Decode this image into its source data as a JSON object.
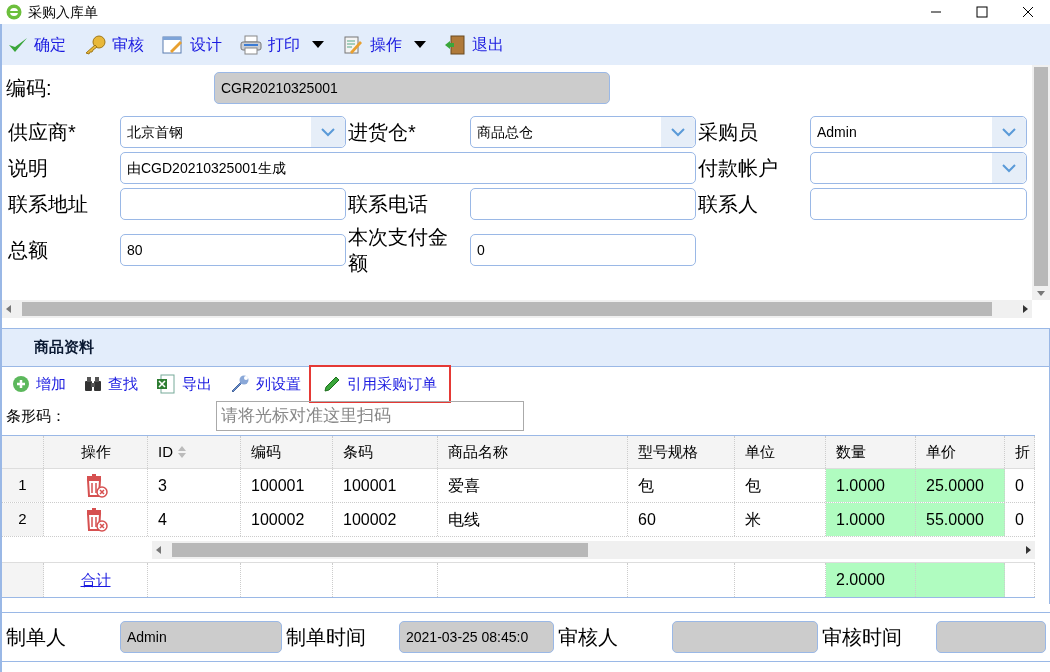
{
  "window": {
    "title": "采购入库单"
  },
  "toolbar": [
    {
      "label": "确定",
      "dropdown": false
    },
    {
      "label": "审核",
      "dropdown": false
    },
    {
      "label": "设计",
      "dropdown": false
    },
    {
      "label": "打印",
      "dropdown": true
    },
    {
      "label": "操作",
      "dropdown": true
    },
    {
      "label": "退出",
      "dropdown": false
    }
  ],
  "form": {
    "code": {
      "label": "编码:",
      "value": "CGR20210325001"
    },
    "rows": [
      [
        {
          "label": "供应商*",
          "value": "北京首钢",
          "kind": "select"
        },
        {
          "label": "进货仓*",
          "value": "商品总仓",
          "kind": "select"
        },
        {
          "label": "采购员",
          "value": "Admin",
          "kind": "select"
        }
      ],
      [
        {
          "label": "说明",
          "value": "由CGD20210325001生成",
          "kind": "text",
          "colspan": 3
        },
        {
          "label": "付款帐户",
          "kind": "select"
        }
      ],
      [
        {
          "label": "联系地址",
          "kind": "text"
        },
        {
          "label": "联系电话",
          "kind": "text"
        },
        {
          "label": "联系人",
          "kind": "text"
        }
      ],
      [
        {
          "label": "总额",
          "value": "80",
          "kind": "text"
        },
        {
          "label": "本次支付金额",
          "value": "0",
          "kind": "text"
        }
      ]
    ]
  },
  "items": {
    "title": "商品资料",
    "toolbar": [
      {
        "label": "增加",
        "highlighted": false
      },
      {
        "label": "查找",
        "highlighted": false
      },
      {
        "label": "导出",
        "highlighted": false
      },
      {
        "label": "列设置",
        "highlighted": false
      },
      {
        "label": "引用采购订单",
        "highlighted": true
      }
    ],
    "barcode": {
      "label": "条形码：",
      "placeholder": "请将光标对准这里扫码"
    },
    "action_column": "操作",
    "columns": [
      {
        "label": "ID",
        "sortable": true
      },
      {
        "label": "编码"
      },
      {
        "label": "条码"
      },
      {
        "label": "商品名称"
      },
      {
        "label": "型号规格"
      },
      {
        "label": "单位"
      },
      {
        "label": "数量",
        "highlighted": true,
        "total": "2.0000"
      },
      {
        "label": "单价",
        "highlighted": true
      },
      {
        "label": "折"
      }
    ],
    "rows": [
      {
        "number": "1",
        "cells": [
          "3",
          "100001",
          "100001",
          "爱喜",
          "包",
          "包",
          "1.0000",
          "25.0000",
          "0"
        ]
      },
      {
        "number": "2",
        "cells": [
          "4",
          "100002",
          "100002",
          "电线",
          "60",
          "米",
          "1.0000",
          "55.0000",
          "0"
        ]
      }
    ],
    "total_label": "合计"
  },
  "footer": [
    {
      "label": "制单人",
      "value": "Admin"
    },
    {
      "label": "制单时间",
      "value": "2021-03-25 08:45:0"
    },
    {
      "label": "审核人"
    },
    {
      "label": "审核时间"
    }
  ]
}
